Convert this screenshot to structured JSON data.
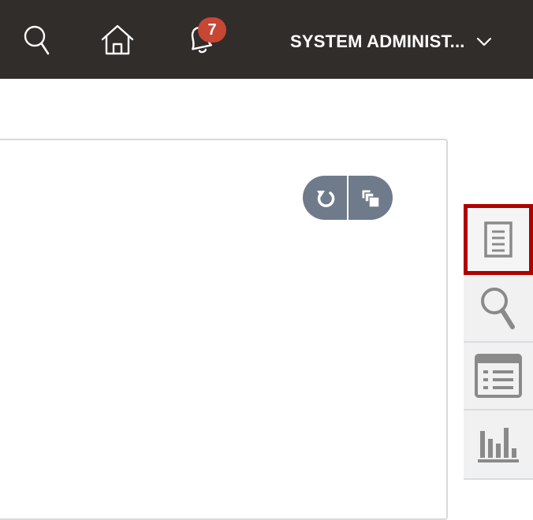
{
  "header": {
    "notification_count": "7",
    "user_label": "SYSTEM ADMINIST..."
  },
  "icons": {
    "search": "search-icon",
    "home": "home-icon",
    "bell": "bell-icon",
    "chevron": "chevron-down-icon",
    "refresh": "refresh-icon",
    "copy": "copy-icon",
    "document": "document-icon",
    "magnifier": "magnifier-icon",
    "list": "list-icon",
    "chart": "bar-chart-icon"
  },
  "colors": {
    "header_bg": "#312d2a",
    "badge": "#c74634",
    "highlight": "#b00000",
    "button": "#6f7b8a"
  }
}
